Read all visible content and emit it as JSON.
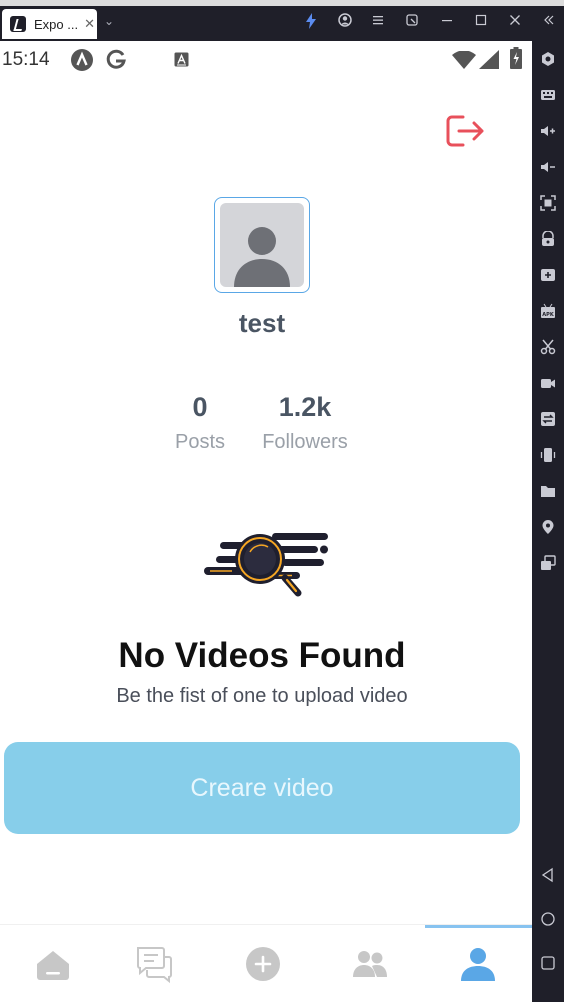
{
  "window": {
    "tab_title": "Expo ...",
    "tab_close": "✕",
    "menu_chevron": "⌄"
  },
  "titlebar_icons": [
    "bolt-icon",
    "user-circle-icon",
    "menu-icon",
    "external-icon",
    "minimize-icon",
    "maximize-icon",
    "close-icon",
    "collapse-icon"
  ],
  "status_bar": {
    "time": "15:14",
    "icons": [
      "app-a-icon",
      "google-g-icon",
      "autofill-icon",
      "wifi-icon",
      "signal-icon",
      "battery-icon"
    ]
  },
  "emulator_sidebar": {
    "icons": [
      "settings-icon",
      "keyboard-icon",
      "volume-up-icon",
      "volume-down-icon",
      "screenshot-icon",
      "lock-icon",
      "add-icon",
      "apk-icon",
      "cut-icon",
      "video-record-icon",
      "sync-icon",
      "shake-icon",
      "folder-icon",
      "location-icon",
      "multi-window-icon",
      "back-icon",
      "home-icon",
      "recent-apps-icon"
    ]
  },
  "profile": {
    "username": "test",
    "stats": [
      {
        "value": "0",
        "label": "Posts"
      },
      {
        "value": "1.2k",
        "label": "Followers"
      }
    ]
  },
  "empty_state": {
    "title": "No Videos Found",
    "subtitle": "Be the fist of one to upload video"
  },
  "create_button": {
    "label": "Creare video"
  },
  "bottom_nav": {
    "items": [
      "home-icon",
      "chat-icon",
      "add-circle-icon",
      "people-icon",
      "profile-icon"
    ],
    "active": "profile-icon"
  },
  "colors": {
    "accent": "#87ceea",
    "avatar_border": "#5aa7e6",
    "logout": "#e8505b",
    "active_nav": "#5aa7e6",
    "text_dark": "#4a5563"
  }
}
